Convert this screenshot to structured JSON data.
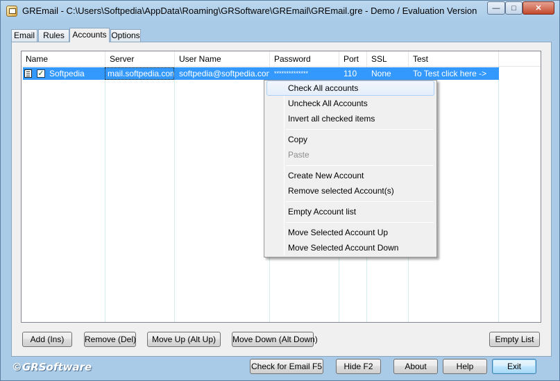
{
  "window": {
    "title": "GREmail - C:\\Users\\Softpedia\\AppData\\Roaming\\GRSoftware\\GREmail\\GREmail.gre - Demo / Evaluation Version"
  },
  "tabs": [
    "Email",
    "Rules",
    "Accounts",
    "Options"
  ],
  "active_tab": "Accounts",
  "accounts_table": {
    "columns": [
      "Name",
      "Server",
      "User Name",
      "Password",
      "Port",
      "SSL",
      "Test"
    ],
    "rows": [
      {
        "checked": true,
        "name": "Softpedia",
        "server": "mail.softpedia.com",
        "user_name": "softpedia@softpedia.com",
        "password": "**************",
        "port": "110",
        "ssl": "None",
        "test": "To Test click here ->"
      }
    ]
  },
  "context_menu": {
    "items": [
      {
        "label": "Check All accounts"
      },
      {
        "label": "Uncheck All Accounts"
      },
      {
        "label": "Invert all checked items"
      },
      {
        "label": "Copy"
      },
      {
        "label": "Paste"
      },
      {
        "label": "Create New Account"
      },
      {
        "label": "Remove selected Account(s)"
      },
      {
        "label": "Empty Account list"
      },
      {
        "label": "Move Selected Account Up"
      },
      {
        "label": "Move Selected Account Down"
      }
    ]
  },
  "list_buttons": {
    "add": "Add (Ins)",
    "remove": "Remove (Del)",
    "move_up": "Move Up (Alt Up)",
    "move_down": "Move Down (Alt Down)",
    "empty": "Empty List"
  },
  "footer": {
    "brand": "©GRSoftware",
    "check_email": "Check for Email F5",
    "hide": "Hide F2",
    "about": "About",
    "help": "Help",
    "exit": "Exit"
  },
  "colors": {
    "selection": "#3399ff",
    "window_frame": "#a9cbe8"
  }
}
